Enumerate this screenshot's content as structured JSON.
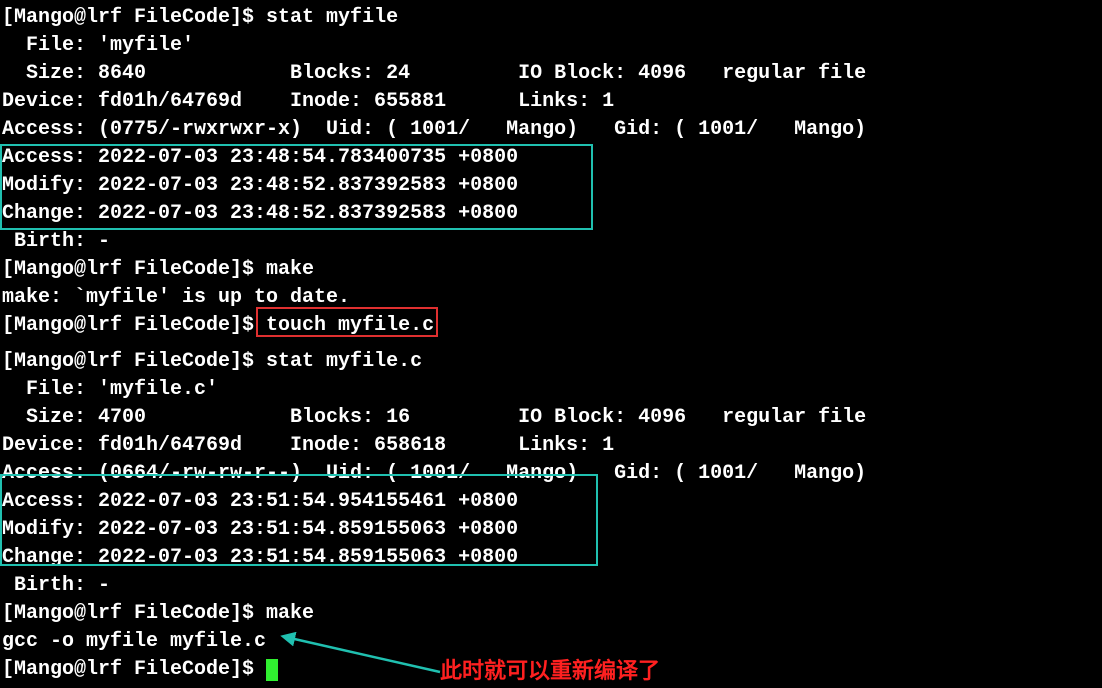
{
  "prompt": {
    "user": "Mango",
    "host": "lrf",
    "dir": "FileCode",
    "sigil": "$"
  },
  "cmd1": "stat myfile",
  "stat1": {
    "file_label": "  File: ",
    "file_value": "'myfile'",
    "size_line": "  Size: 8640            Blocks: 24         IO Block: 4096   regular file",
    "device_line": "Device: fd01h/64769d    Inode: 655881      Links: 1",
    "access_perm": "Access: (0775/-rwxrwxr-x)  Uid: ( 1001/   Mango)   Gid: ( 1001/   Mango)",
    "access_time": "Access: 2022-07-03 23:48:54.783400735 +0800",
    "modify_time": "Modify: 2022-07-03 23:48:52.837392583 +0800",
    "change_time": "Change: 2022-07-03 23:48:52.837392583 +0800",
    "birth_line": " Birth: -"
  },
  "cmd2": "make",
  "make1_out": "make: `myfile' is up to date.",
  "cmd3": "touch myfile.c",
  "cmd4": "stat myfile.c",
  "stat2": {
    "file_label": "  File: ",
    "file_value": "'myfile.c'",
    "size_line": "  Size: 4700            Blocks: 16         IO Block: 4096   regular file",
    "device_line": "Device: fd01h/64769d    Inode: 658618      Links: 1",
    "access_perm": "Access: (0664/-rw-rw-r--)  Uid: ( 1001/   Mango)   Gid: ( 1001/   Mango)",
    "access_time": "Access: 2022-07-03 23:51:54.954155461 +0800",
    "modify_time": "Modify: 2022-07-03 23:51:54.859155063 +0800",
    "change_time": "Change: 2022-07-03 23:51:54.859155063 +0800",
    "birth_line": " Birth: -"
  },
  "cmd5": "make",
  "make2_out": "gcc -o myfile myfile.c",
  "annotation_text": "此时就可以重新编译了"
}
